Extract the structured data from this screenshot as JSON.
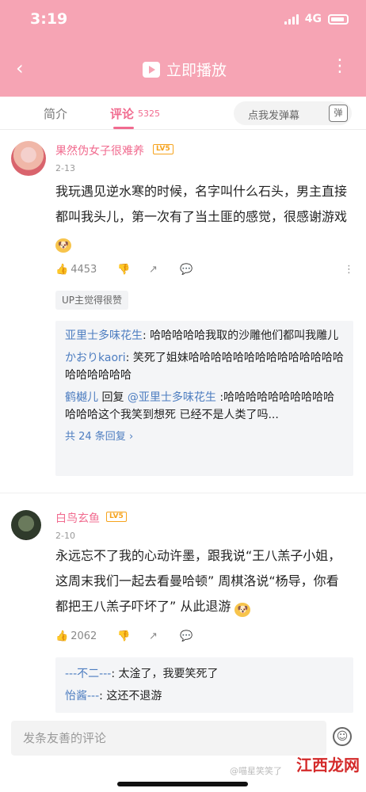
{
  "status": {
    "time": "3:19",
    "network": "4G"
  },
  "nav": {
    "back": "‹",
    "title": "立即播放",
    "more": "⋮"
  },
  "tabs": {
    "intro": "简介",
    "comments": "评论",
    "count": "5325",
    "danmaku": "点我发弹幕",
    "dan_icon": "弹"
  },
  "comments": [
    {
      "name": "果然伪女子很难养",
      "level": "LV5",
      "date": "2-13",
      "text": "我玩遇见逆水寒的时候，名字叫什么石头，男主直接都叫我头儿，第一次有了当土匪的感觉，很感谢游戏",
      "likes": "4453",
      "up_badge": "UP主觉得很赞",
      "replies": [
        {
          "user": "亚里士多味花生",
          "text": ": 哈哈哈哈哈我取的沙雕他们都叫我雕儿"
        },
        {
          "user": "かおりkaori",
          "text": ": 笑死了姐妹哈哈哈哈哈哈哈哈哈哈哈哈哈哈哈哈哈哈哈哈"
        },
        {
          "user": "鹤樾儿",
          "reply": " 回复 ",
          "target": "@亚里士多味花生",
          "text": " :哈哈哈哈哈哈哈哈哈哈哈哈哈这个我笑到想死 已经不是人类了吗..."
        }
      ],
      "more": "共 24 条回复 ›"
    },
    {
      "name": "白鸟玄鱼",
      "level": "LV5",
      "date": "2-10",
      "text": "永远忘不了我的心动许墨，跟我说“王八羔子小姐，这周末我们一起去看曼哈顿” 周棋洛说“杨导，你看都把王八羔子吓坏了” 从此退游",
      "likes": "2062",
      "replies": [
        {
          "user": "---不二---",
          "text": ": 太淦了，我要笑死了"
        },
        {
          "user": "怡酱---",
          "text": ": 这还不退游"
        }
      ]
    }
  ],
  "input": {
    "placeholder": "发条友善的评论"
  },
  "watermark": "@喵星笑笑了",
  "site_logo": "江西龙网"
}
